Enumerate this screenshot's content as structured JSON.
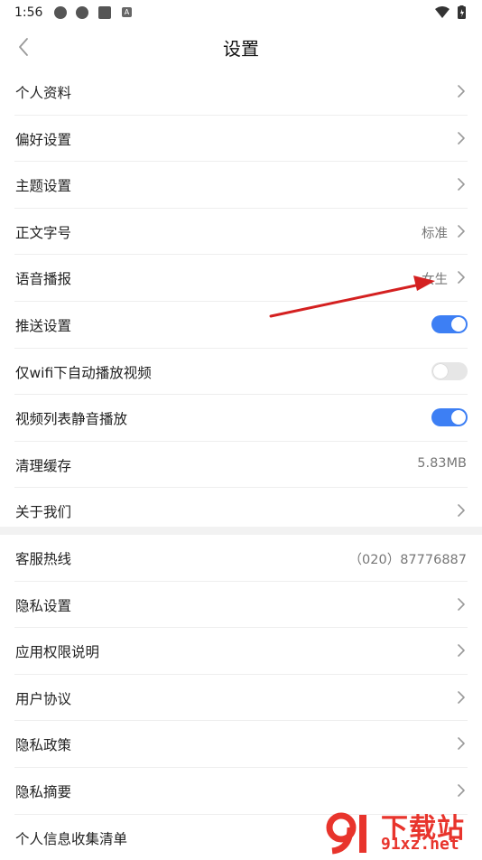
{
  "status_bar": {
    "time": "1:56",
    "badge_letter": "A"
  },
  "nav": {
    "title": "设置"
  },
  "colors": {
    "accent": "#3d7ff4",
    "arrow": "#d42020",
    "divider": "#eeeeee"
  },
  "group1": [
    {
      "label": "个人资料",
      "value": "",
      "control": "chevron"
    },
    {
      "label": "偏好设置",
      "value": "",
      "control": "chevron"
    },
    {
      "label": "主题设置",
      "value": "",
      "control": "chevron"
    },
    {
      "label": "正文字号",
      "value": "标准",
      "control": "chevron"
    },
    {
      "label": "语音播报",
      "value": "女生",
      "control": "chevron"
    },
    {
      "label": "推送设置",
      "value": "",
      "control": "toggle",
      "on": true
    },
    {
      "label": "仅wifi下自动播放视频",
      "value": "",
      "control": "toggle",
      "on": false
    },
    {
      "label": "视频列表静音播放",
      "value": "",
      "control": "toggle",
      "on": true
    },
    {
      "label": "清理缓存",
      "value": "5.83MB",
      "control": "none"
    },
    {
      "label": "关于我们",
      "value": "",
      "control": "chevron"
    }
  ],
  "group2": [
    {
      "label": "客服热线",
      "value": "（020）87776887",
      "control": "none"
    },
    {
      "label": "隐私设置",
      "value": "",
      "control": "chevron"
    },
    {
      "label": "应用权限说明",
      "value": "",
      "control": "chevron"
    },
    {
      "label": "用户协议",
      "value": "",
      "control": "chevron"
    },
    {
      "label": "隐私政策",
      "value": "",
      "control": "chevron"
    },
    {
      "label": "隐私摘要",
      "value": "",
      "control": "chevron"
    },
    {
      "label": "个人信息收集清单",
      "value": "",
      "control": "none"
    }
  ],
  "watermark": {
    "text": "下载站",
    "url": "91xz.net"
  }
}
